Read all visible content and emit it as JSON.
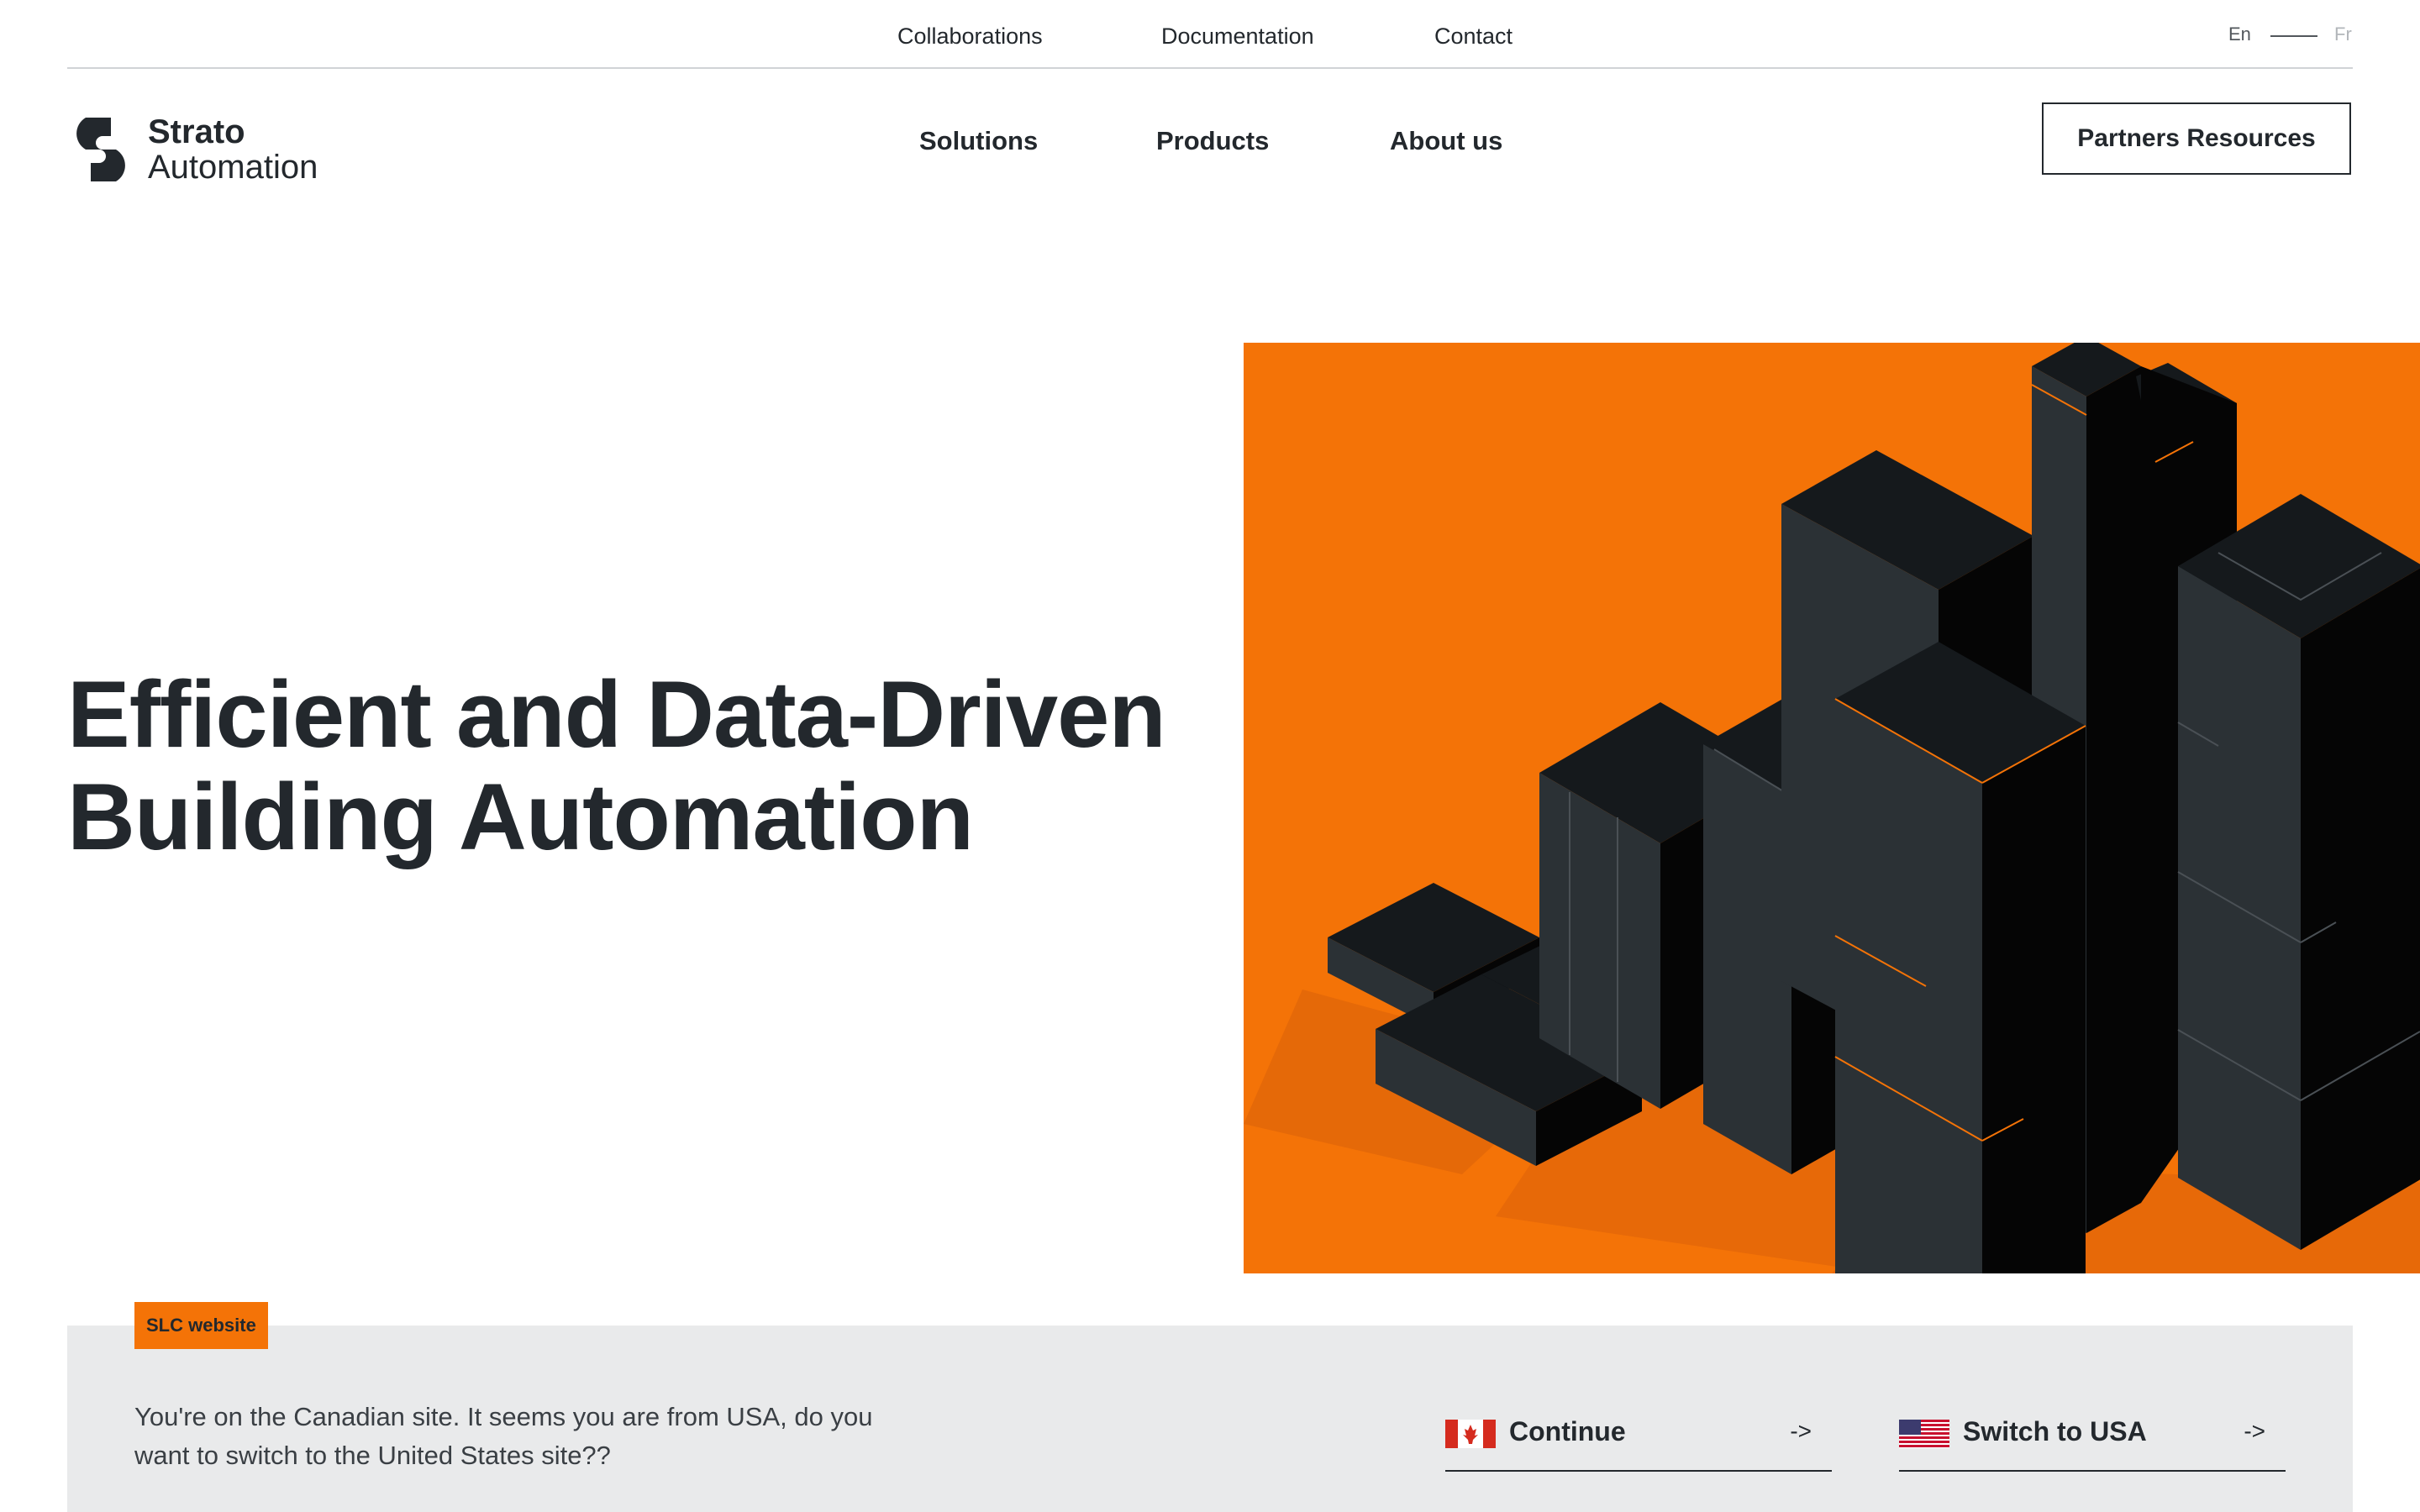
{
  "utility_nav": {
    "links": [
      "Collaborations",
      "Documentation",
      "Contact"
    ],
    "languages": {
      "current": "En",
      "other": "Fr"
    }
  },
  "brand": {
    "name": "Strato",
    "subtitle": "Automation"
  },
  "main_nav": {
    "links": [
      "Solutions",
      "Products",
      "About us"
    ],
    "cta_label": "Partners Resources"
  },
  "hero": {
    "title_line1": "Efficient and Data-Driven",
    "title_line2": "Building Automation"
  },
  "geo_banner": {
    "tag": "SLC website",
    "message": "You're on the Canadian site. It seems you are from USA, do you want to switch to the United States site??",
    "continue_label": "Continue",
    "switch_label": "Switch to USA",
    "arrow": "->"
  },
  "icons": [
    "logo-icon",
    "canada-flag-icon",
    "usa-flag-icon",
    "arrow-right-icon"
  ],
  "colors": {
    "accent_orange": "#f47307",
    "text_dark": "#23282d",
    "banner_bg": "#e9eaeb"
  }
}
